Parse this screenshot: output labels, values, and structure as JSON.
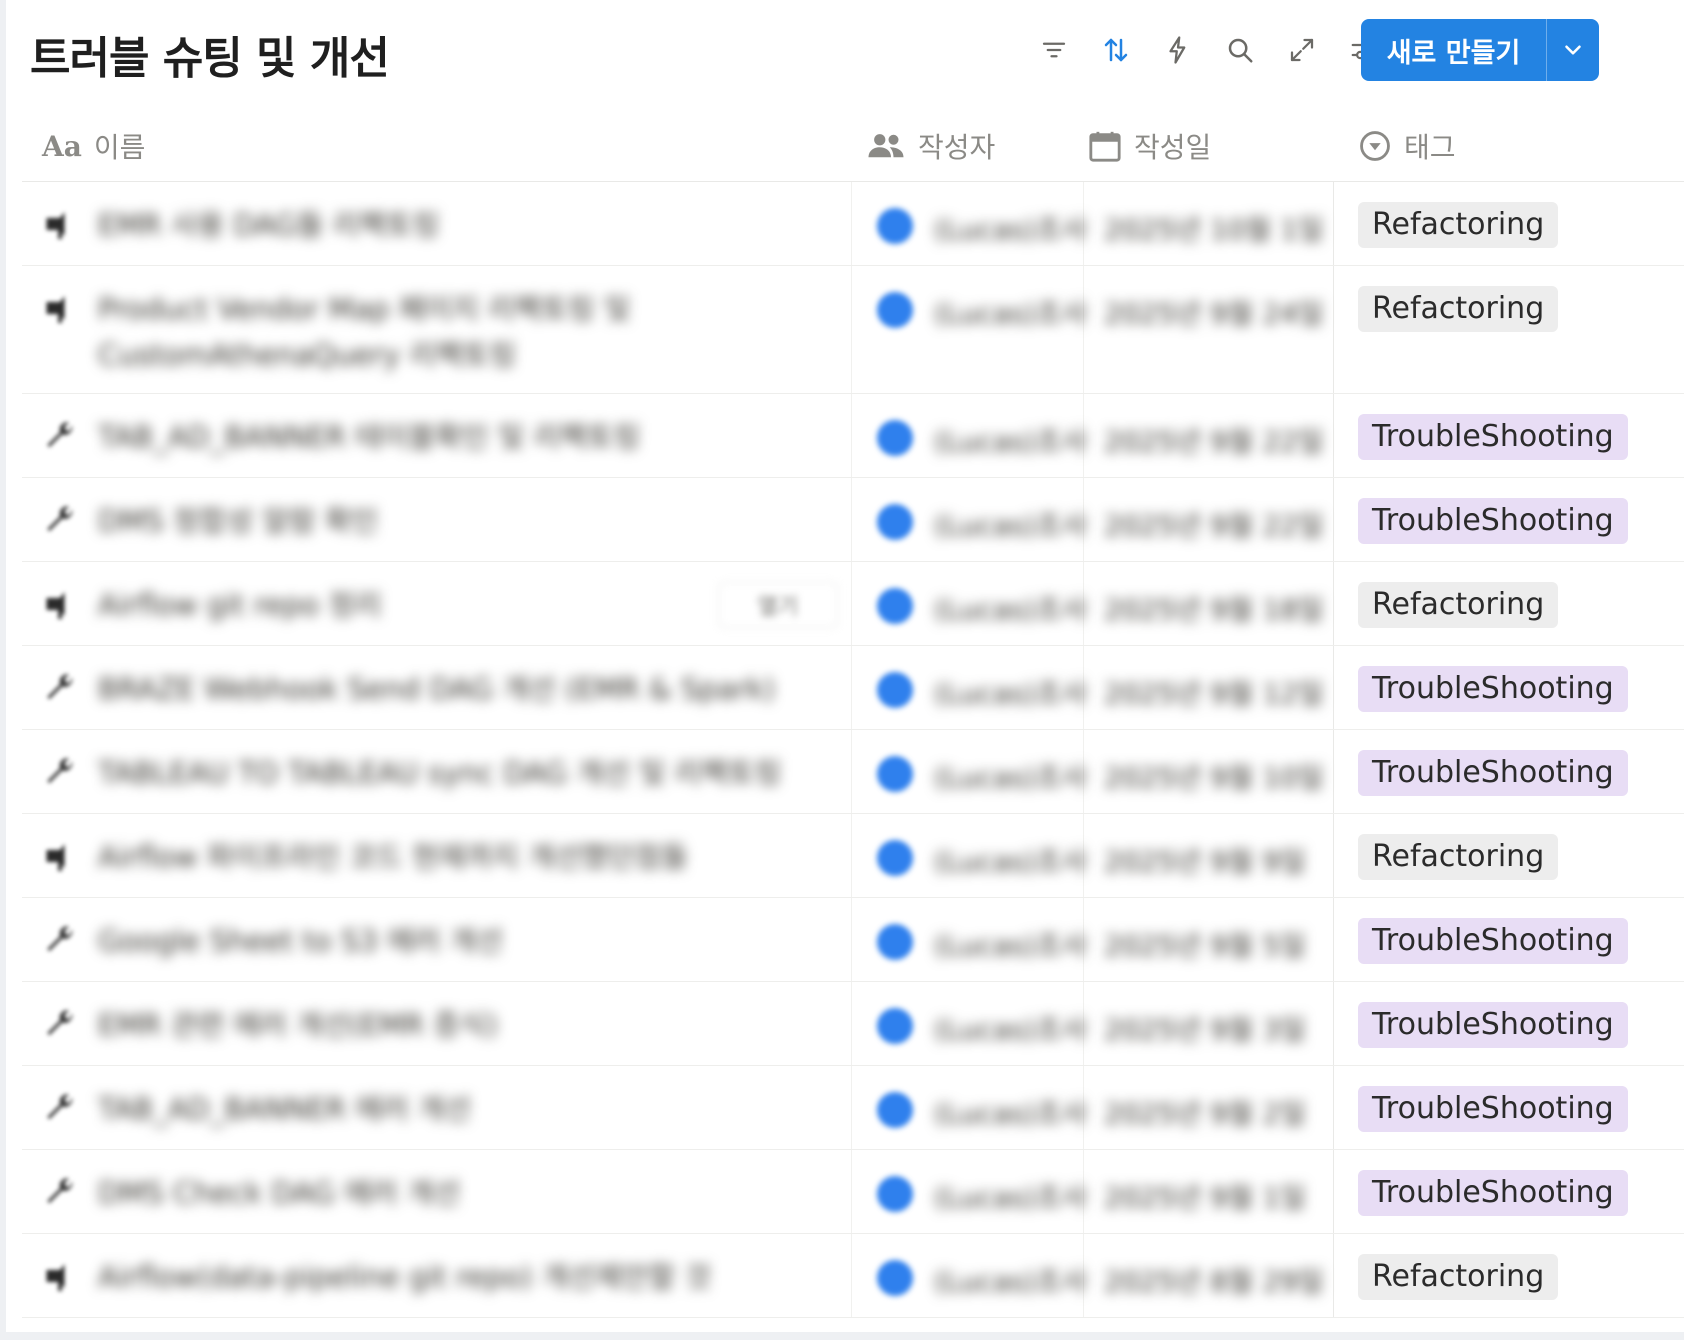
{
  "page": {
    "title": "트러블 슈팅 및 개선",
    "new_button_label": "새로 만들기"
  },
  "toolbar": {
    "icons": [
      "filter-icon",
      "sort-icon",
      "lightning-icon",
      "search-icon",
      "expand-icon",
      "settings-icon"
    ],
    "sort_active_color": "#2383e2"
  },
  "columns": {
    "name": "이름",
    "author": "작성자",
    "date": "작성일",
    "tag": "태그"
  },
  "tags": {
    "Refactoring": {
      "bg": "#ededed",
      "fg": "#2b2b2b"
    },
    "TroubleShooting": {
      "bg": "#e8ddf5",
      "fg": "#2b2b2b"
    }
  },
  "rows": [
    {
      "icon": "pushpin-icon",
      "title": "EMR 사용 DAG들 리팩토링",
      "author": "(Lucas)조사",
      "date": "2025년 10월 1일",
      "tag": "Refactoring",
      "lines": 1
    },
    {
      "icon": "pushpin-icon",
      "title": "Product Vendor Map 페이지 리팩토링 및 CustomAthenaQuery 리팩토링",
      "author": "(Lucas)조사",
      "date": "2025년 9월 24일",
      "tag": "Refactoring",
      "lines": 2
    },
    {
      "icon": "wrench-icon",
      "title": "TAB_AD_BANNER 테이블확인 및 리팩토링",
      "author": "(Lucas)조사",
      "date": "2025년 9월 22일",
      "tag": "TroubleShooting",
      "lines": 1
    },
    {
      "icon": "wrench-icon",
      "title": "DMS 정합성 알람 확인",
      "author": "(Lucas)조사",
      "date": "2025년 9월 22일",
      "tag": "TroubleShooting",
      "lines": 1
    },
    {
      "icon": "pushpin-icon",
      "title": "Airflow git repo 정리",
      "author": "(Lucas)조사",
      "date": "2025년 9월 18일",
      "tag": "Refactoring",
      "lines": 1,
      "open_label": "열기"
    },
    {
      "icon": "wrench-icon",
      "title": "BRAZE Webhook Send DAG 개선 (EMR & Spark)",
      "author": "(Lucas)조사",
      "date": "2025년 9월 12일",
      "tag": "TroubleShooting",
      "lines": 1
    },
    {
      "icon": "wrench-icon",
      "title": "TABLEAU TO TABLEAU sync DAG 개선 및 리팩토링",
      "author": "(Lucas)조사",
      "date": "2025년 9월 10일",
      "tag": "TroubleShooting",
      "lines": 1
    },
    {
      "icon": "pushpin-icon",
      "title": "Airflow 파이프라인 코드 현재까지 개선했던점들",
      "author": "(Lucas)조사",
      "date": "2025년 9월 9일",
      "tag": "Refactoring",
      "lines": 1
    },
    {
      "icon": "wrench-icon",
      "title": "Google Sheet to S3 에러 개선",
      "author": "(Lucas)조사",
      "date": "2025년 9월 5일",
      "tag": "TroubleShooting",
      "lines": 1
    },
    {
      "icon": "wrench-icon",
      "title": "EMR 관련 에러 개선(EMR 증식)",
      "author": "(Lucas)조사",
      "date": "2025년 9월 3일",
      "tag": "TroubleShooting",
      "lines": 1
    },
    {
      "icon": "wrench-icon",
      "title": "TAB_AD_BANNER 에러 개선",
      "author": "(Lucas)조사",
      "date": "2025년 9월 2일",
      "tag": "TroubleShooting",
      "lines": 1
    },
    {
      "icon": "wrench-icon",
      "title": "DMS Check DAG 에러 개선",
      "author": "(Lucas)조사",
      "date": "2025년 9월 1일",
      "tag": "TroubleShooting",
      "lines": 1
    },
    {
      "icon": "pushpin-icon",
      "title": "Airflow(data-pipeline git repo) 개선제안할 것",
      "author": "(Lucas)조사",
      "date": "2025년 8월 29일",
      "tag": "Refactoring",
      "lines": 1
    }
  ]
}
